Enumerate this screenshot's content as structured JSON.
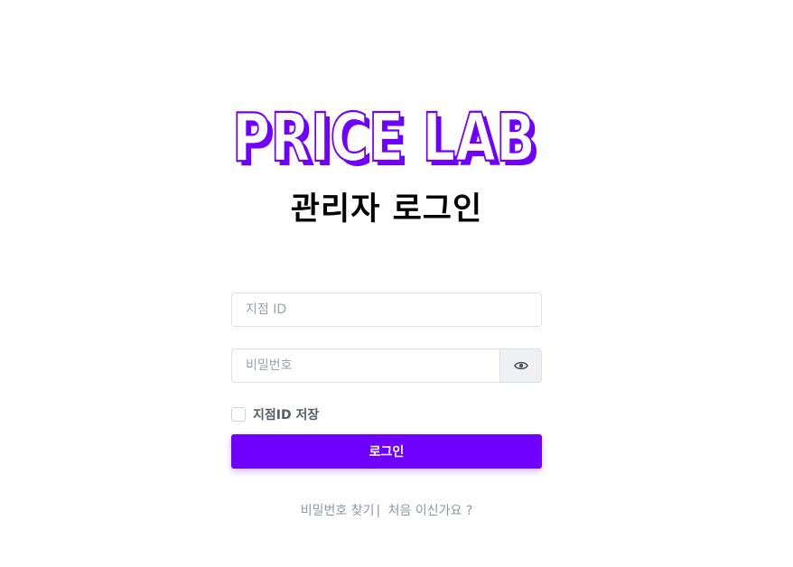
{
  "logo": {
    "text": "PRICE LAB",
    "color": "#6f00ff"
  },
  "page_title": "관리자 로그인",
  "branch_id": {
    "value": "",
    "placeholder": "지점 ID"
  },
  "password": {
    "value": "",
    "placeholder": "비밀번호",
    "toggle_icon": "eye-icon"
  },
  "remember": {
    "label": "지점ID 저장",
    "checked": false
  },
  "login_button": {
    "label": "로그인",
    "color": "#6f00ff"
  },
  "links": {
    "find_password": "비밀번호 찾기",
    "separator": "|",
    "first_visit": "처음 이신가요 ?"
  }
}
